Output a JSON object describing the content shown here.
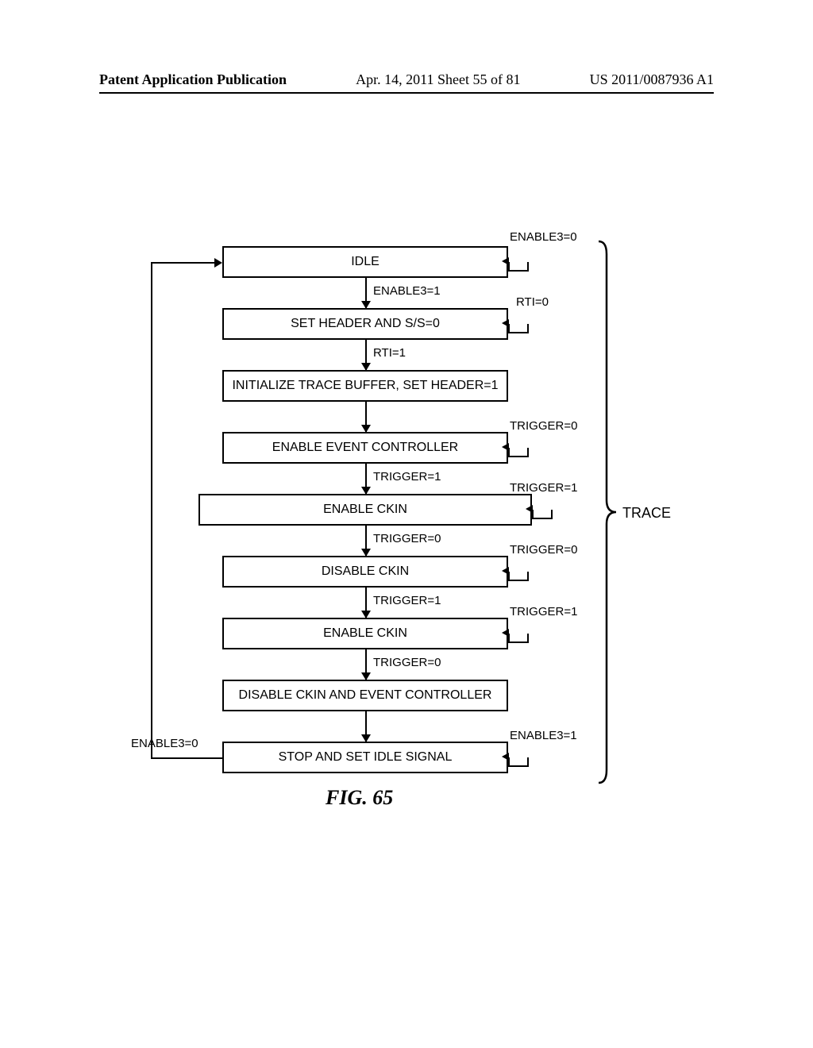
{
  "header": {
    "left": "Patent Application Publication",
    "mid": "Apr. 14, 2011  Sheet 55 of 81",
    "right": "US 2011/0087936 A1"
  },
  "figure_caption": "FIG. 65",
  "brace_label": "TRACE",
  "boxes": {
    "b1": "IDLE",
    "b2": "SET HEADER AND S/S=0",
    "b3": "INITIALIZE TRACE BUFFER, SET HEADER=1",
    "b4": "ENABLE EVENT CONTROLLER",
    "b5": "ENABLE CKIN",
    "b6": "DISABLE CKIN",
    "b7": "ENABLE CKIN",
    "b8": "DISABLE CKIN AND EVENT CONTROLLER",
    "b9": "STOP AND SET IDLE SIGNAL"
  },
  "arrow_labels": {
    "a12": "ENABLE3=1",
    "a23": "RTI=1",
    "a45": "TRIGGER=1",
    "a56": "TRIGGER=0",
    "a67": "TRIGGER=1",
    "a78": "TRIGGER=0"
  },
  "self_loops": {
    "s1": "ENABLE3=0",
    "s2": "RTI=0",
    "s4": "TRIGGER=0",
    "s5": "TRIGGER=1",
    "s6": "TRIGGER=0",
    "s7": "TRIGGER=1",
    "s9": "ENABLE3=1"
  },
  "feedback_label": "ENABLE3=0"
}
